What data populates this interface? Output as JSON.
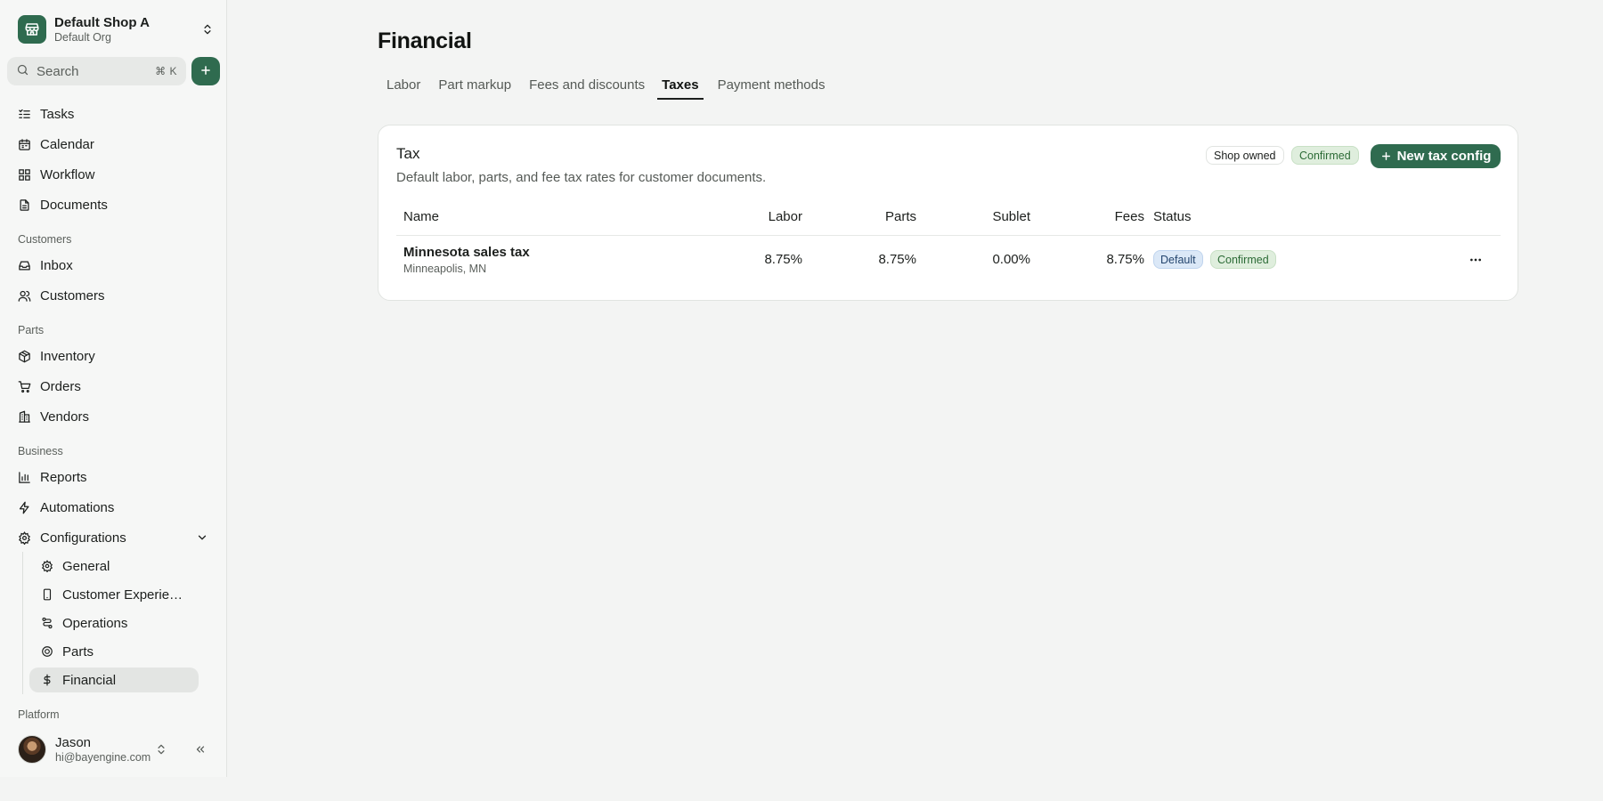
{
  "shop": {
    "name": "Default Shop A",
    "org": "Default Org"
  },
  "search": {
    "placeholder": "Search",
    "shortcut": "⌘ K"
  },
  "nav": {
    "main": [
      {
        "label": "Tasks",
        "icon": "tasks-icon"
      },
      {
        "label": "Calendar",
        "icon": "calendar-icon"
      },
      {
        "label": "Workflow",
        "icon": "workflow-icon"
      },
      {
        "label": "Documents",
        "icon": "document-icon"
      }
    ],
    "customers_label": "Customers",
    "customers": [
      {
        "label": "Inbox",
        "icon": "inbox-icon"
      },
      {
        "label": "Customers",
        "icon": "users-icon"
      }
    ],
    "parts_label": "Parts",
    "parts": [
      {
        "label": "Inventory",
        "icon": "box-icon"
      },
      {
        "label": "Orders",
        "icon": "cart-icon"
      },
      {
        "label": "Vendors",
        "icon": "building-icon"
      }
    ],
    "business_label": "Business",
    "business": [
      {
        "label": "Reports",
        "icon": "bar-chart-icon"
      },
      {
        "label": "Automations",
        "icon": "lightning-icon"
      },
      {
        "label": "Configurations",
        "icon": "gear-icon"
      }
    ],
    "config_sub": [
      {
        "label": "General",
        "icon": "gear-icon"
      },
      {
        "label": "Customer Experience",
        "icon": "phone-icon"
      },
      {
        "label": "Operations",
        "icon": "route-icon"
      },
      {
        "label": "Parts",
        "icon": "tire-icon"
      },
      {
        "label": "Financial",
        "icon": "dollar-icon"
      }
    ],
    "platform_label": "Platform"
  },
  "user": {
    "name": "Jason",
    "email": "hi@bayengine.com"
  },
  "page": {
    "title": "Financial",
    "tabs": [
      "Labor",
      "Part markup",
      "Fees and discounts",
      "Taxes",
      "Payment methods"
    ],
    "active_tab": "Taxes"
  },
  "card": {
    "title": "Tax",
    "description": "Default labor, parts, and fee tax rates for customer documents.",
    "badge_owner": "Shop owned",
    "badge_status": "Confirmed",
    "new_button": "New tax config",
    "columns": [
      "Name",
      "Labor",
      "Parts",
      "Sublet",
      "Fees",
      "Status"
    ],
    "rows": [
      {
        "name": "Minnesota sales tax",
        "location": "Minneapolis, MN",
        "labor": "8.75%",
        "parts": "8.75%",
        "sublet": "0.00%",
        "fees": "8.75%",
        "status_default": "Default",
        "status_confirmed": "Confirmed"
      }
    ]
  },
  "colors": {
    "brand": "#2f6b4f",
    "confirmed_bg": "#dfeedd",
    "default_bg": "#dbe8f7"
  }
}
